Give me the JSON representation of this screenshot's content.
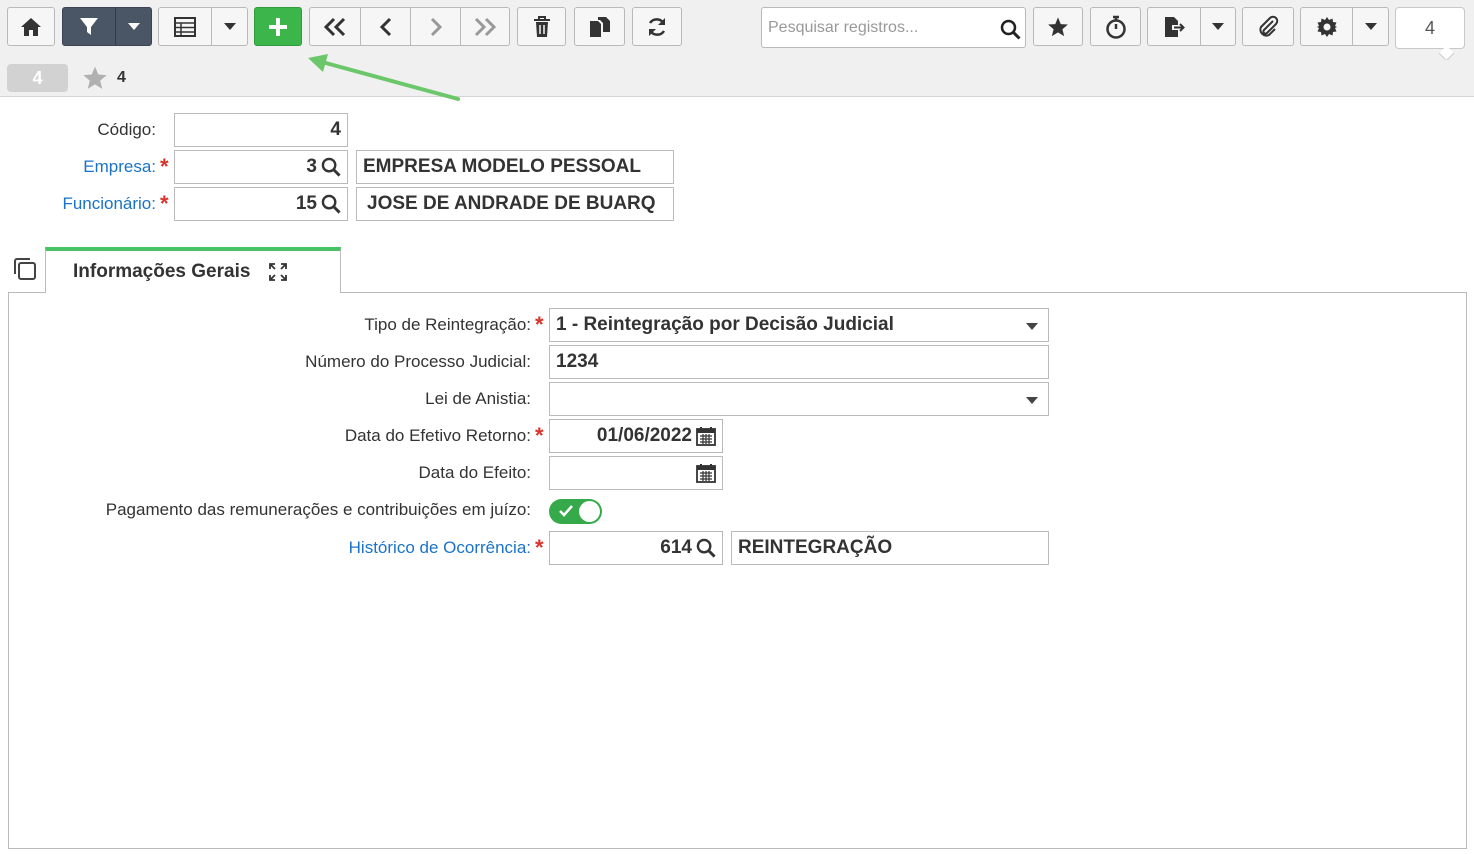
{
  "toolbar": {
    "search_placeholder": "Pesquisar registros...",
    "record_counter": "4",
    "buttons": {
      "home": "home-icon",
      "filter": "filter-icon",
      "grid": "table-icon",
      "add": "plus-icon",
      "first": "double-chevron-left-icon",
      "prev": "chevron-left-icon",
      "next": "chevron-right-icon",
      "last": "double-chevron-right-icon",
      "delete": "trash-icon",
      "copy": "copy-icon",
      "refresh": "refresh-icon",
      "favorite": "star-icon",
      "timer": "stopwatch-icon",
      "export": "export-icon",
      "attach": "paperclip-icon",
      "settings": "gear-icon"
    }
  },
  "subbar": {
    "record_badge": "4",
    "favorite_label": "4"
  },
  "header_form": {
    "codigo": {
      "label": "Código:",
      "value": "4"
    },
    "empresa": {
      "label": "Empresa:",
      "code": "3",
      "description": "EMPRESA MODELO PESSOAL"
    },
    "funcionario": {
      "label": "Funcionário:",
      "code": "15",
      "description": "JOSE DE ANDRADE DE BUARQ"
    }
  },
  "tab": {
    "label": "Informações Gerais"
  },
  "form": {
    "tipo_reintegracao": {
      "label": "Tipo de Reintegração:",
      "value": "1 - Reintegração por Decisão Judicial"
    },
    "numero_processo": {
      "label": "Número do Processo Judicial:",
      "value": "1234"
    },
    "lei_anistia": {
      "label": "Lei de Anistia:",
      "value": ""
    },
    "data_retorno": {
      "label": "Data do Efetivo Retorno:",
      "value": "01/06/2022"
    },
    "data_efeito": {
      "label": "Data do Efeito:",
      "value": ""
    },
    "pagamento": {
      "label": "Pagamento das remunerações e contribuições em juízo:",
      "checked": true
    },
    "historico": {
      "label": "Histórico de Ocorrência:",
      "code": "614",
      "description": "REINTEGRAÇÃO"
    }
  },
  "colors": {
    "accent_green": "#3cb54a",
    "link_blue": "#1a73c8",
    "required_red": "#d9342b",
    "filter_dark": "#4a5565"
  }
}
